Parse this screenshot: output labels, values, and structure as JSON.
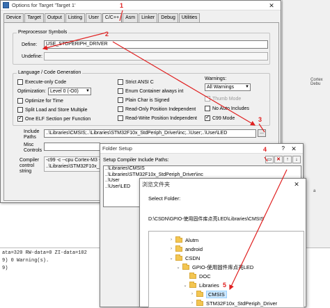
{
  "main_dialog": {
    "title": "Options for Target 'Target 1'",
    "close": "✕",
    "tabs": [
      "Device",
      "Target",
      "Output",
      "Listing",
      "User",
      "C/C++",
      "Asm",
      "Linker",
      "Debug",
      "Utilities"
    ],
    "preprocessor": {
      "title": "Preprocessor Symbols",
      "define_label": "Define:",
      "define_value": "USE_STDPERIPH_DRIVER",
      "undefine_label": "Undefine:",
      "undefine_value": ""
    },
    "language": {
      "title": "Language / Code Generation",
      "execute_only": "Execute-only Code",
      "optimization_label": "Optimization:",
      "optimization_value": "Level 0 (-O0)",
      "optimize_time": "Optimize for Time",
      "split_load": "Split Load and Store Multiple",
      "one_elf": "One ELF Section per Function",
      "strict_ansi": "Strict ANSI C",
      "enum_int": "Enum Container always int",
      "plain_char": "Plain Char is Signed",
      "ro_pos": "Read-Only Position Independent",
      "rw_pos": "Read-Write Position Independent",
      "warnings_label": "Warnings:",
      "warnings_value": "All Warnings",
      "thumb_mode": "Thumb Mode",
      "no_auto_includes": "No Auto Includes",
      "c99_mode": "C99 Mode"
    },
    "include_paths_label": "Include Paths",
    "include_paths_value": "..\\Libraries\\CMSIS;..\\Libraries\\STM32F10x_StdPeriph_Driver\\inc;..\\User;..\\User\\LED",
    "browse_btn": "...",
    "misc_label": "Misc Controls",
    "compiler_label": "Compiler control string",
    "compiler_line1": "-c99 -c --cpu Cortex-M3 -D_",
    "compiler_line2": "..\\Libraries\\STM32F10x_StdP"
  },
  "folder_setup": {
    "title": "Folder Setup",
    "help": "?",
    "close": "✕",
    "label": "Setup Compiler Include Paths:",
    "paths": [
      "..\\Libraries\\CMSIS",
      "..\\Libraries\\STM32F10x_StdPeriph_Driver\\inc",
      "..\\User",
      "..\\User\\LED"
    ]
  },
  "browse": {
    "title": "浏览文件夹",
    "close": "✕",
    "select_folder": "Select Folder:",
    "path": "D:\\CSDN\\GPIO-使用固件库点亮LED\\Libraries\\CMSIS",
    "tree": [
      {
        "label": "Alutm",
        "expander": "›",
        "selected": false
      },
      {
        "label": "android",
        "expander": "›",
        "selected": false
      },
      {
        "label": "CSDN",
        "expander": "⌄",
        "selected": false
      },
      {
        "label": "GPIO-使用固件库点亮LED",
        "expander": "⌄",
        "selected": false
      },
      {
        "label": "DOC",
        "expander": "",
        "selected": false
      },
      {
        "label": "Libraries",
        "expander": "⌄",
        "selected": false
      },
      {
        "label": "CMSIS",
        "expander": "›",
        "selected": true
      },
      {
        "label": "STM32F10x_StdPeriph_Driver",
        "expander": "›",
        "selected": false
      }
    ]
  },
  "ide": {
    "side_text": "Cortex Debu",
    "side_text2": "a",
    "output_lines": [
      "ata=320 RW-data=0 ZI-data=102",
      "9) 0 Warning(s).",
      "9)"
    ]
  },
  "annotations": [
    "1",
    "2",
    "3",
    "4",
    "5"
  ],
  "colors": {
    "annotation": "#e02020",
    "selection": "#cce8ff"
  }
}
